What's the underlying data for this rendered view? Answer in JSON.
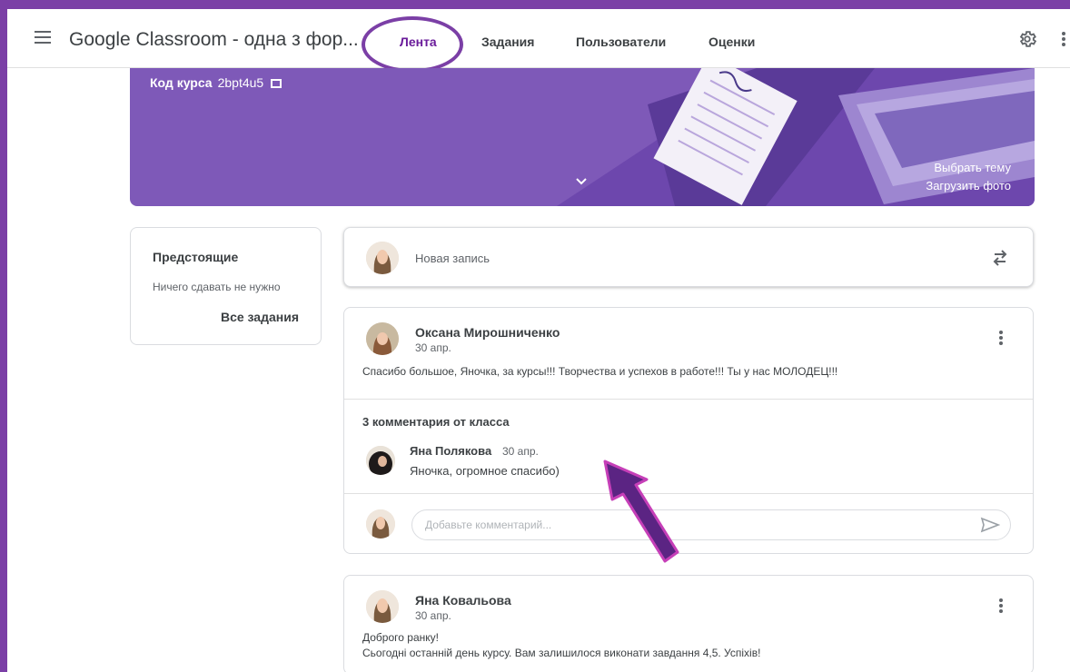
{
  "header": {
    "title": "Google Classroom - одна з фор...",
    "tabs": [
      {
        "label": "Лента",
        "active": true
      },
      {
        "label": "Задания",
        "active": false
      },
      {
        "label": "Пользователи",
        "active": false
      },
      {
        "label": "Оценки",
        "active": false
      }
    ],
    "icons": [
      "menu-icon",
      "gear-icon",
      "more-vert-icon"
    ]
  },
  "banner": {
    "course_code_label": "Код курса",
    "course_code": "2bpt4u5",
    "choose_theme": "Выбрать тему",
    "upload_photo": "Загрузить фото",
    "background_color": "#7e59b8"
  },
  "upcoming": {
    "title": "Предстоящие",
    "empty_text": "Ничего сдавать не нужно",
    "all_link": "Все задания"
  },
  "composer": {
    "placeholder": "Новая запись"
  },
  "posts": [
    {
      "author": "Оксана Мирошниченко",
      "date": "30 апр.",
      "text": "Спасибо большое, Яночка, за курсы!!! Творчества и успехов в работе!!! Ты у нас МОЛОДЕЦ!!!",
      "comments_label": "3 комментария от класса",
      "comments": [
        {
          "author": "Яна Полякова",
          "date": "30 апр.",
          "text": "Яночка, огромное спасибо)"
        }
      ],
      "comment_placeholder": "Добавьте комментарий..."
    },
    {
      "author": "Яна Ковальова",
      "date": "30 апр.",
      "text_lines": [
        "Доброго ранку!",
        "Сьогодні останній день курсу. Вам залишилося виконати завдання 4,5. Успіхів!"
      ]
    }
  ],
  "colors": {
    "annotation": "#7b3fa6",
    "active_tab": "#6a1b9a"
  }
}
